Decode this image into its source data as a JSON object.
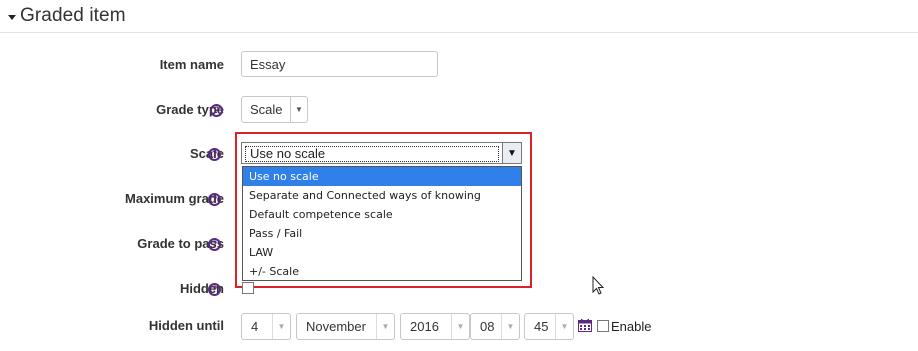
{
  "section": {
    "title": "Graded item"
  },
  "item_name": {
    "label": "Item name",
    "value": "Essay"
  },
  "grade_type": {
    "label": "Grade type",
    "value": "Scale"
  },
  "scale": {
    "label": "Scale",
    "value": "Use no scale",
    "options": [
      "Use no scale",
      "Separate and Connected ways of knowing",
      "Default competence scale",
      "Pass / Fail",
      "LAW",
      "+/- Scale"
    ],
    "highlighted_index": 0
  },
  "maximum_grade": {
    "label": "Maximum grade"
  },
  "grade_to_pass": {
    "label": "Grade to pass"
  },
  "hidden": {
    "label": "Hidden",
    "checked": false
  },
  "hidden_until": {
    "label": "Hidden until",
    "day": "4",
    "month": "November",
    "year": "2016",
    "hour": "08",
    "minute": "45",
    "enable_label": "Enable",
    "enable_checked": false
  },
  "colors": {
    "accent": "#2f80e8",
    "highlight_border": "#d9222a",
    "help_icon": "#5a2a82"
  }
}
